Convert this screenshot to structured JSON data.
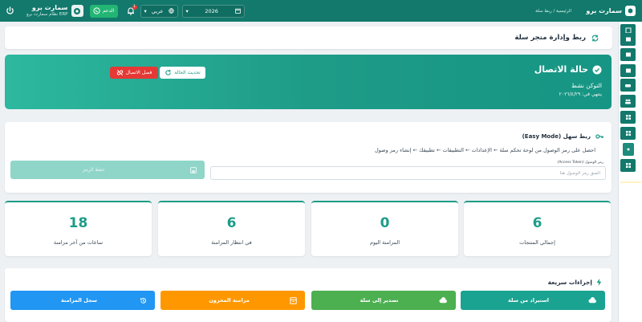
{
  "topbar": {
    "brand": "سمارت برو",
    "breadcrumb": "الرئيسية / ربط سلة",
    "account_name": "سمارت برو",
    "account_sub": "نظام سمارت برو ERP",
    "support_label": "الدعم",
    "notification_count": "1",
    "language": "عربي",
    "year": "2026"
  },
  "page": {
    "title": "ربط وإدارة متجر سلة"
  },
  "status": {
    "title": "حالة الاتصال",
    "token_state": "التوكن نشط",
    "expires": "ينتهي في: ٢٠٢٦/٤/٢٩",
    "refresh_label": "تحديث الحالة",
    "disconnect_label": "فصل الاتصال"
  },
  "easy": {
    "title": "ربط سهل (Easy Mode)",
    "description": "احصل على رمز الوصول من لوحة تحكم سلة ← الإعدادات ← التطبيقات ← تطبيقك ← إنشاء رمز وصول",
    "token_label": "رمز الوصول (Access Token)",
    "token_placeholder": "الصق رمز الوصول هنا",
    "save_label": "حفظ الرمز"
  },
  "stats": [
    {
      "value": "6",
      "label": "إجمالي المنتجات"
    },
    {
      "value": "0",
      "label": "المزامنة اليوم"
    },
    {
      "value": "6",
      "label": "في انتظار المزامنة"
    },
    {
      "value": "18",
      "label": "ساعات من آخر مزامنة"
    }
  ],
  "quick": {
    "title": "إجراءات سريعة",
    "actions": [
      {
        "label": "استيراد من سلة",
        "color": "#1aa391"
      },
      {
        "label": "تصدير إلى سلة",
        "color": "#4caf50"
      },
      {
        "label": "مزامنة المخزون",
        "color": "#ff9800"
      },
      {
        "label": "سجل المزامنة",
        "color": "#2196f3"
      }
    ]
  },
  "colors": {
    "primary": "#12796c",
    "accent": "#1e9c88",
    "danger": "#e53935"
  }
}
